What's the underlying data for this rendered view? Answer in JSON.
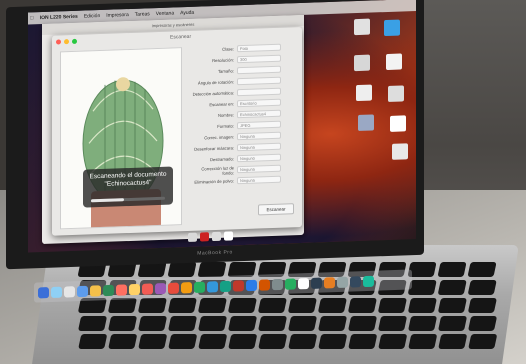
{
  "menubar": {
    "app_name": "ION L220 Series",
    "items": [
      "Edición",
      "Impresora",
      "Tareas",
      "Ventana",
      "Ayuda"
    ]
  },
  "background_window": {
    "title": "Impresoras y escáneres"
  },
  "dialog": {
    "title": "Escanear"
  },
  "scan_overlay": {
    "line1": "Escaneando el documento",
    "line2": "\"Echinocactus4\"",
    "progress": 0.45
  },
  "form": {
    "rows": [
      {
        "label": "Clase:",
        "value": "Foto"
      },
      {
        "label": "Resolución:",
        "value": "300"
      },
      {
        "label": "Tamaño:",
        "value": ""
      },
      {
        "label": "Ángulo de rotación:",
        "value": ""
      },
      {
        "label": "Detección automática:",
        "value": ""
      },
      {
        "label": "Escanear en:",
        "value": "Escritorio"
      },
      {
        "label": "Nombre:",
        "value": "Echinocactus4"
      },
      {
        "label": "Formato:",
        "value": "JPEG"
      },
      {
        "label": "Correc. imagen:",
        "value": "Ninguna"
      },
      {
        "label": "Desenfocar máscara:",
        "value": "Ninguna"
      },
      {
        "label": "Destramado:",
        "value": "Ninguno"
      },
      {
        "label": "Corrección luz de fondo:",
        "value": "Ninguna"
      },
      {
        "label": "Eliminación de polvo:",
        "value": "Ninguna"
      }
    ],
    "scan_button": "Escanear"
  },
  "bezel": {
    "brand": "MacBook Pro"
  },
  "colors": {
    "wallpaper_orange": "#c6451f",
    "wallpaper_dark": "#1a1733",
    "bezel": "#1b1b1b",
    "aluminum": "#b9b9b9"
  }
}
